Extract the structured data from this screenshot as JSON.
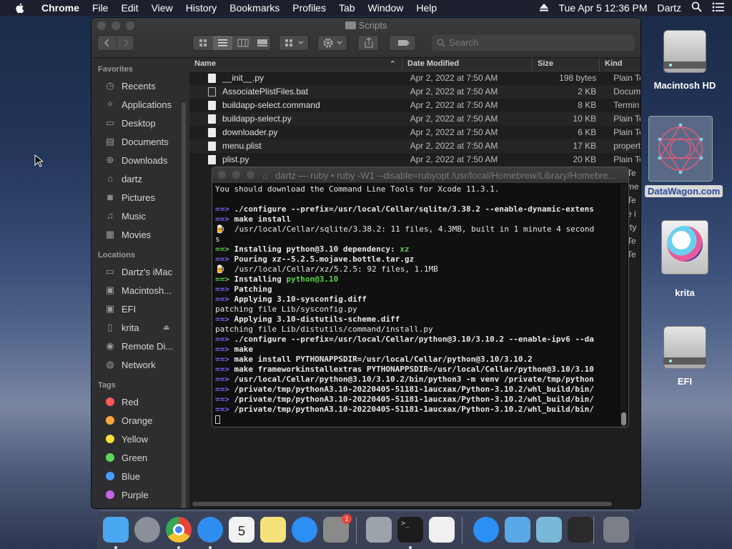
{
  "menubar": {
    "app_name": "Chrome",
    "menus": [
      "File",
      "Edit",
      "View",
      "History",
      "Bookmarks",
      "Profiles",
      "Tab",
      "Window",
      "Help"
    ],
    "clock": "Tue Apr 5  12:36 PM",
    "user": "Dartz"
  },
  "desktop": {
    "icons": [
      {
        "label": "Macintosh HD",
        "icon": "hard-drive-icon"
      },
      {
        "label": "DataWagon.com",
        "icon": "datawagon-icon"
      },
      {
        "label": "krita",
        "icon": "krita-disk-icon"
      },
      {
        "label": "EFI",
        "icon": "hard-drive-icon"
      }
    ]
  },
  "finder": {
    "title": "Scripts",
    "search_placeholder": "Search",
    "sidebar": {
      "favorites_header": "Favorites",
      "favorites": [
        {
          "label": "Recents",
          "icon": "clock-icon"
        },
        {
          "label": "Applications",
          "icon": "applications-icon"
        },
        {
          "label": "Desktop",
          "icon": "desktop-icon"
        },
        {
          "label": "Documents",
          "icon": "documents-icon"
        },
        {
          "label": "Downloads",
          "icon": "downloads-icon"
        },
        {
          "label": "dartz",
          "icon": "home-icon"
        },
        {
          "label": "Pictures",
          "icon": "camera-icon"
        },
        {
          "label": "Music",
          "icon": "music-icon"
        },
        {
          "label": "Movies",
          "icon": "film-icon"
        }
      ],
      "locations_header": "Locations",
      "locations": [
        {
          "label": "Dartz's iMac",
          "icon": "imac-icon"
        },
        {
          "label": "Macintosh...",
          "icon": "disk-icon"
        },
        {
          "label": "EFI",
          "icon": "disk-icon"
        },
        {
          "label": "krita",
          "icon": "disk-icon"
        },
        {
          "label": "Remote Di...",
          "icon": "remote-disc-icon"
        },
        {
          "label": "Network",
          "icon": "globe-icon"
        }
      ],
      "tags_header": "Tags",
      "tags": [
        {
          "label": "Red",
          "color": "#ff5a5a"
        },
        {
          "label": "Orange",
          "color": "#ffa53a"
        },
        {
          "label": "Yellow",
          "color": "#f6df3a"
        },
        {
          "label": "Green",
          "color": "#5fd45a"
        },
        {
          "label": "Blue",
          "color": "#4a9cff"
        },
        {
          "label": "Purple",
          "color": "#c466e6"
        }
      ]
    },
    "columns": {
      "name": "Name",
      "date": "Date Modified",
      "size": "Size",
      "kind": "Kind"
    },
    "files": [
      {
        "name": "__init__.py",
        "date": "Apr 2, 2022 at 7:50 AM",
        "size": "198 bytes",
        "kind": "Plain Tex"
      },
      {
        "name": "AssociatePlistFiles.bat",
        "date": "Apr 2, 2022 at 7:50 AM",
        "size": "2 KB",
        "kind": "Docume"
      },
      {
        "name": "buildapp-select.command",
        "date": "Apr 2, 2022 at 7:50 AM",
        "size": "8 KB",
        "kind": "Termin"
      },
      {
        "name": "buildapp-select.py",
        "date": "Apr 2, 2022 at 7:50 AM",
        "size": "10 KB",
        "kind": "Plain Tex"
      },
      {
        "name": "downloader.py",
        "date": "Apr 2, 2022 at 7:50 AM",
        "size": "6 KB",
        "kind": "Plain Tex"
      },
      {
        "name": "menu.plist",
        "date": "Apr 2, 2022 at 7:50 AM",
        "size": "17 KB",
        "kind": "property"
      },
      {
        "name": "plist.py",
        "date": "Apr 2, 2022 at 7:50 AM",
        "size": "20 KB",
        "kind": "Plain Tex"
      }
    ],
    "kind_peek": [
      "Te",
      "me",
      "Te",
      "e i",
      "rty",
      "Te",
      "Te"
    ]
  },
  "terminal": {
    "title": "dartz — ruby • ruby -W1 --disable=rubyopt /usr/local/Homebrew/Library/Homebre...",
    "lines": [
      {
        "style": "n",
        "segs": [
          [
            "",
            "You should download the Command Line Tools for Xcode 11.3.1."
          ]
        ]
      },
      {
        "style": "n",
        "segs": [
          [
            "",
            ""
          ]
        ]
      },
      {
        "style": "b",
        "segs": [
          [
            "ar",
            "==> "
          ],
          [
            "",
            "./configure --prefix=/usr/local/Cellar/sqlite/3.38.2 --enable-dynamic-extens"
          ]
        ]
      },
      {
        "style": "b",
        "segs": [
          [
            "ar",
            "==> "
          ],
          [
            "",
            "make install"
          ]
        ]
      },
      {
        "style": "n",
        "segs": [
          [
            "",
            "🍺  /usr/local/Cellar/sqlite/3.38.2: 11 files, 4.3MB, built in 1 minute 4 second"
          ]
        ]
      },
      {
        "style": "n",
        "segs": [
          [
            "",
            "s"
          ]
        ]
      },
      {
        "style": "b",
        "segs": [
          [
            "gr",
            "==> "
          ],
          [
            "",
            "Installing python@3.10 dependency: "
          ],
          [
            "gr",
            "xz"
          ]
        ]
      },
      {
        "style": "b",
        "segs": [
          [
            "ar",
            "==> "
          ],
          [
            "",
            "Pouring xz--5.2.5.mojave.bottle.tar.gz"
          ]
        ]
      },
      {
        "style": "n",
        "segs": [
          [
            "",
            "🍺  /usr/local/Cellar/xz/5.2.5: 92 files, 1.1MB"
          ]
        ]
      },
      {
        "style": "b",
        "segs": [
          [
            "gr",
            "==> "
          ],
          [
            "",
            "Installing "
          ],
          [
            "gr",
            "python@3.10"
          ]
        ]
      },
      {
        "style": "b",
        "segs": [
          [
            "ar",
            "==> "
          ],
          [
            "",
            "Patching"
          ]
        ]
      },
      {
        "style": "b",
        "segs": [
          [
            "ar",
            "==> "
          ],
          [
            "",
            "Applying 3.10-sysconfig.diff"
          ]
        ]
      },
      {
        "style": "n",
        "segs": [
          [
            "",
            "patching file Lib/sysconfig.py"
          ]
        ]
      },
      {
        "style": "b",
        "segs": [
          [
            "ar",
            "==> "
          ],
          [
            "",
            "Applying 3.10-distutils-scheme.diff"
          ]
        ]
      },
      {
        "style": "n",
        "segs": [
          [
            "",
            "patching file Lib/distutils/command/install.py"
          ]
        ]
      },
      {
        "style": "b",
        "segs": [
          [
            "ar",
            "==> "
          ],
          [
            "",
            "./configure --prefix=/usr/local/Cellar/python@3.10/3.10.2 --enable-ipv6 --da"
          ]
        ]
      },
      {
        "style": "b",
        "segs": [
          [
            "ar",
            "==> "
          ],
          [
            "",
            "make"
          ]
        ]
      },
      {
        "style": "b",
        "segs": [
          [
            "ar",
            "==> "
          ],
          [
            "",
            "make install PYTHONAPPSDIR=/usr/local/Cellar/python@3.10/3.10.2"
          ]
        ]
      },
      {
        "style": "b",
        "segs": [
          [
            "ar",
            "==> "
          ],
          [
            "",
            "make frameworkinstallextras PYTHONAPPSDIR=/usr/local/Cellar/python@3.10/3.10"
          ]
        ]
      },
      {
        "style": "b",
        "segs": [
          [
            "ar",
            "==> "
          ],
          [
            "",
            "/usr/local/Cellar/python@3.10/3.10.2/bin/python3 -m venv /private/tmp/python"
          ]
        ]
      },
      {
        "style": "b",
        "segs": [
          [
            "ar",
            "==> "
          ],
          [
            "",
            "/private/tmp/pythonA3.10-20220405-51181-1aucxax/Python-3.10.2/whl_build/bin/"
          ]
        ]
      },
      {
        "style": "b",
        "segs": [
          [
            "ar",
            "==> "
          ],
          [
            "",
            "/private/tmp/pythonA3.10-20220405-51181-1aucxax/Python-3.10.2/whl_build/bin/"
          ]
        ]
      },
      {
        "style": "b",
        "segs": [
          [
            "ar",
            "==> "
          ],
          [
            "",
            "/private/tmp/pythonA3.10-20220405-51181-1aucxax/Python-3.10.2/whl_build/bin/"
          ]
        ]
      }
    ]
  },
  "dock": {
    "apps": [
      {
        "name": "Finder",
        "icon": "finder-icon",
        "color": "#4aa8f0",
        "running": true
      },
      {
        "name": "Launchpad",
        "icon": "rocket-icon",
        "color": "#8a8f9a",
        "running": false
      },
      {
        "name": "Chrome",
        "icon": "chrome-icon",
        "color": "#e8e8e8",
        "running": true
      },
      {
        "name": "Safari",
        "icon": "safari-icon",
        "color": "#2e8ef0",
        "running": true
      },
      {
        "name": "Calendar",
        "icon": "calendar-icon",
        "color": "#f2f2f2",
        "running": false,
        "text": "5"
      },
      {
        "name": "Notes",
        "icon": "notes-icon",
        "color": "#f5e27a",
        "running": false
      },
      {
        "name": "App Store",
        "icon": "app-store-icon",
        "color": "#2b8ff5",
        "running": false
      },
      {
        "name": "System Preferences",
        "icon": "gear-icon",
        "color": "#8a8a8a",
        "running": false,
        "badge": "1"
      },
      {
        "name": "FontForge",
        "icon": "font-icon",
        "color": "#9aa4aa",
        "running": false
      },
      {
        "name": "Terminal",
        "icon": "terminal-icon",
        "color": "#1c1c1c",
        "running": true
      },
      {
        "name": "TextEdit",
        "icon": "textedit-icon",
        "color": "#f0f0f0",
        "running": false
      },
      {
        "name": "Applications",
        "icon": "app-store-icon",
        "color": "#2b8ff5",
        "running": false
      },
      {
        "name": "Documents",
        "icon": "folder-icon",
        "color": "#5aa8e6",
        "running": false
      },
      {
        "name": "Downloads",
        "icon": "image-stack-icon",
        "color": "#7ab8d8",
        "running": false
      },
      {
        "name": "Window",
        "icon": "window-icon",
        "color": "#2a2a2a",
        "running": false
      },
      {
        "name": "Trash",
        "icon": "trash-icon",
        "color": "#7a7f88",
        "running": false
      }
    ]
  }
}
